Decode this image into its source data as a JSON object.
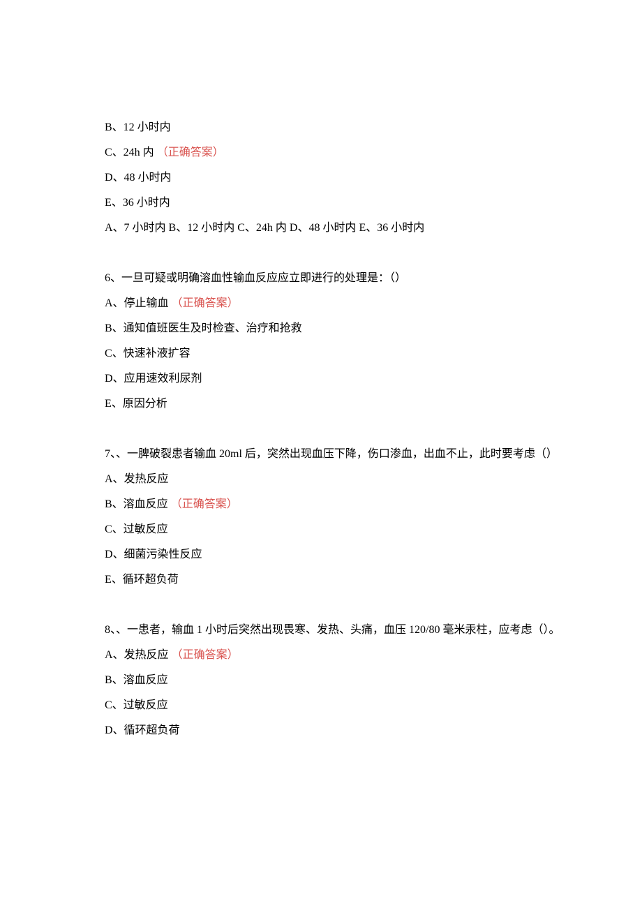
{
  "q5": {
    "b": "B、12 小时内",
    "c_text": "C、24h 内",
    "c_answer": "（正确答案）",
    "d": "D、48 小时内",
    "e": "E、36 小时内",
    "summary": "A、7 小时内 B、12 小时内 C、24h 内 D、48 小时内 E、36 小时内"
  },
  "q6": {
    "stem": "6、一旦可疑或明确溶血性输血反应应立即进行的处理是：（）",
    "a_text": "A、停止输血",
    "a_answer": "（正确答案）",
    "b": "B、通知值班医生及时检查、治疗和抢救",
    "c": "C、快速补液扩容",
    "d": "D、应用速效利尿剂",
    "e": "E、原因分析"
  },
  "q7": {
    "stem": "7、、一脾破裂患者输血 20ml 后，突然出现血压下降，伤口渗血，出血不止，此时要考虑（）",
    "a": "A、发热反应",
    "b_text": "B、溶血反应",
    "b_answer": "（正确答案）",
    "c": "C、过敏反应",
    "d": "D、细菌污染性反应",
    "e": "E、循环超负荷"
  },
  "q8": {
    "stem": "8、、一患者，输血 1 小时后突然出现畏寒、发热、头痛，血压 120/80 毫米汞柱，应考虑（）。",
    "a_text": "A、发热反应",
    "a_answer": "（正确答案）",
    "b": "B、溶血反应",
    "c": "C、过敏反应",
    "d": "D、循环超负荷"
  }
}
